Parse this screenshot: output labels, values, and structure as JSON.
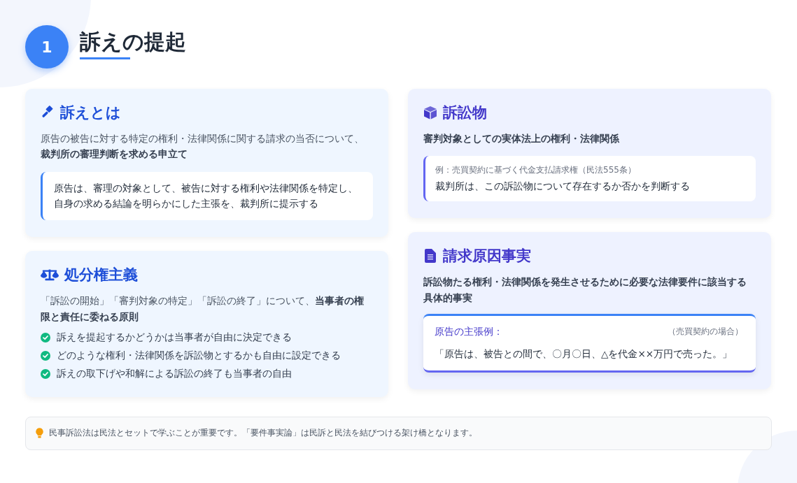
{
  "header": {
    "number": "1",
    "title": "訴えの提起"
  },
  "left_column": {
    "cards": [
      {
        "kind": "quote",
        "title": "訴えとは",
        "description": "原告の被告に対する特定の権利・法律関係に関する請求の当否について、**裁判所の審理判断を求める申立て**",
        "quote": "原告は、審理の対象として、被告に対する権利や法律関係を特定し、自身の求める結論を明らかにした主張を、裁判所に提示する"
      },
      {
        "kind": "checklist",
        "title": "処分権主義",
        "description": "「訴訟の開始」「審判対象の特定」「訴訟の終了」について、**当事者の権限と責任に委ねる原則**",
        "items": [
          "訴えを提起するかどうかは当事者が自由に決定できる",
          "どのような権利・法律関係を訴訟物とするかも自由に設定できる",
          "訴えの取下げや和解による訴訟の終了も当事者の自由"
        ]
      }
    ]
  },
  "right_column": {
    "cards": [
      {
        "kind": "example",
        "title": "訴訟物",
        "description": "審判対象としての実体法上の権利・法律関係",
        "example_note": "例：売買契約に基づく代金支払請求権（民法555条）",
        "example_text": "裁判所は、この訴訟物について存在するか否かを判断する"
      },
      {
        "kind": "claim",
        "title": "請求原因事実",
        "description": "訴訟物たる権利・法律関係を発生させるために必要な法律要件に該当する具体的事実",
        "claim_label": "原告の主張例：",
        "claim_context": "（売買契約の場合）",
        "claim_text": "「原告は、被告との間で、〇月〇日、△を代金××万円で売った。」"
      }
    ]
  },
  "footer": {
    "text": "民事訴訟法は民法とセットで学ぶことが重要です。「要件事実論」は民訴と民法を結びつける架け橋となります。"
  }
}
